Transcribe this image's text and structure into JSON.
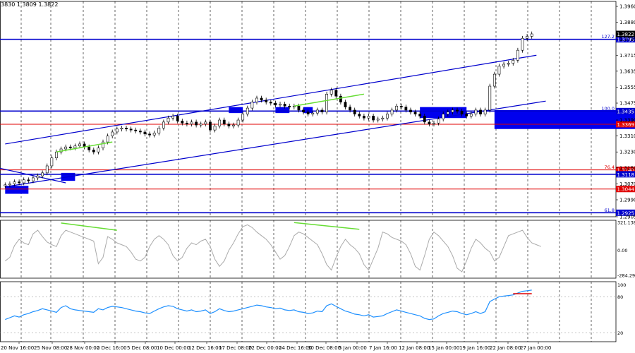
{
  "header": {
    "ohlc_text": "3830 1.3809 1.3822"
  },
  "chart_data": {
    "type": "candlestick",
    "price": {
      "ylim": [
        1.2905,
        1.3985
      ],
      "tick_labels": [
        "1.3960",
        "1.3880",
        "1.3795",
        "1.3715",
        "1.3635",
        "1.3555",
        "1.3475",
        "1.3390",
        "1.3310",
        "1.3230",
        "1.3150",
        "1.3070",
        "1.2990",
        "1.2905"
      ],
      "tick_values": [
        1.396,
        1.388,
        1.3795,
        1.3715,
        1.3635,
        1.3555,
        1.3475,
        1.339,
        1.331,
        1.323,
        1.315,
        1.307,
        1.299,
        1.2905
      ],
      "current_price": {
        "label": "1.3822",
        "value": 1.3822
      },
      "close_series": [
        1.3065,
        1.307,
        1.308,
        1.3075,
        1.309,
        1.3085,
        1.31,
        1.311,
        1.3125,
        1.316,
        1.32,
        1.323,
        1.3245,
        1.3255,
        1.325,
        1.326,
        1.327,
        1.3255,
        1.324,
        1.323,
        1.325,
        1.328,
        1.331,
        1.333,
        1.3345,
        1.335,
        1.3345,
        1.334,
        1.3335,
        1.333,
        1.332,
        1.3315,
        1.3325,
        1.335,
        1.338,
        1.34,
        1.341,
        1.3385,
        1.3375,
        1.337,
        1.338,
        1.3365,
        1.337,
        1.338,
        1.334,
        1.336,
        1.339,
        1.337,
        1.336,
        1.3365,
        1.339,
        1.342,
        1.345,
        1.348,
        1.35,
        1.349,
        1.348,
        1.3475,
        1.3465,
        1.347,
        1.346,
        1.3455,
        1.346,
        1.344,
        1.343,
        1.342,
        1.3425,
        1.344,
        1.343,
        1.352,
        1.354,
        1.351,
        1.348,
        1.3455,
        1.344,
        1.342,
        1.341,
        1.34,
        1.341,
        1.339,
        1.3395,
        1.34,
        1.342,
        1.344,
        1.346,
        1.3455,
        1.344,
        1.343,
        1.342,
        1.341,
        1.338,
        1.337,
        1.3375,
        1.3395,
        1.342,
        1.343,
        1.344,
        1.3435,
        1.342,
        1.341,
        1.342,
        1.344,
        1.342,
        1.344,
        1.356,
        1.362,
        1.366,
        1.367,
        1.3675,
        1.369,
        1.374,
        1.38,
        1.381,
        1.3822
      ],
      "lines": [
        {
          "label": "1.3795",
          "level_text": "127.2",
          "value": 1.3795,
          "color": "#0000cd"
        },
        {
          "label": "1.3435",
          "level_text": "100.0",
          "value": 1.3435,
          "color": "#0000cd"
        },
        {
          "label": "1.3369",
          "level_text": "",
          "value": 1.3369,
          "color": "#e00000"
        },
        {
          "label": "1.3140",
          "level_text": "76.4",
          "value": 1.314,
          "color": "#e00000"
        },
        {
          "label": "1.3118",
          "level_text": "",
          "value": 1.3118,
          "color": "#0000cd"
        },
        {
          "label": "1.3044",
          "level_text": "",
          "value": 1.3044,
          "color": "#e00000"
        },
        {
          "label": "1.2925",
          "level_text": "61.8",
          "value": 1.2925,
          "color": "#0000cd"
        }
      ],
      "channel": {
        "upper": [
          [
            0,
            1.327
          ],
          [
            114,
            1.3715
          ]
        ],
        "lower": [
          [
            0,
            1.3055
          ],
          [
            116,
            1.3485
          ]
        ],
        "color": "#0000cd"
      },
      "zones": [
        {
          "i0": 0,
          "i1": 5,
          "y0": 1.306,
          "y1": 1.302
        },
        {
          "i0": 12,
          "i1": 15,
          "y0": 1.3125,
          "y1": 1.3085
        },
        {
          "i0": 48,
          "i1": 51,
          "y0": 1.3455,
          "y1": 1.3425
        },
        {
          "i0": 58,
          "i1": 61,
          "y0": 1.3455,
          "y1": 1.3425
        },
        {
          "i0": 64,
          "i1": 66,
          "y0": 1.3455,
          "y1": 1.3425
        },
        {
          "i0": 89,
          "i1": 99,
          "y0": 1.3455,
          "y1": 1.34
        },
        {
          "i0": 105,
          "i1": 141,
          "y0": 1.344,
          "y1": 1.3345
        }
      ],
      "divergence_lines": [
        {
          "i0": 11,
          "v0": 1.323,
          "i1": 23,
          "v1": 1.328,
          "color": "#66dd33"
        },
        {
          "i0": 62,
          "v0": 1.346,
          "i1": 77,
          "v1": 1.352,
          "color": "#66dd33"
        }
      ]
    },
    "cci": {
      "tick_labels": [
        "321.1386",
        "0.00",
        "-284.290"
      ],
      "tick_values": [
        321.1386,
        0,
        -284.29
      ],
      "ylim": [
        -310,
        330
      ],
      "series": [
        -120,
        -80,
        50,
        120,
        80,
        60,
        180,
        220,
        150,
        90,
        60,
        40,
        160,
        220,
        200,
        180,
        160,
        140,
        120,
        100,
        -150,
        -80,
        150,
        120,
        80,
        60,
        40,
        -20,
        -100,
        -120,
        -80,
        40,
        120,
        160,
        120,
        60,
        -60,
        -120,
        -80,
        20,
        80,
        60,
        100,
        120,
        40,
        -100,
        -180,
        -120,
        0,
        80,
        180,
        260,
        280,
        250,
        200,
        160,
        120,
        60,
        -20,
        -100,
        -60,
        40,
        160,
        200,
        180,
        140,
        100,
        60,
        -40,
        -160,
        -220,
        -80,
        40,
        120,
        60,
        20,
        -40,
        -160,
        -220,
        -100,
        20,
        200,
        180,
        140,
        120,
        100,
        60,
        -40,
        -180,
        -220,
        -60,
        120,
        200,
        160,
        100,
        40,
        -60,
        -200,
        -240,
        -120,
        20,
        120,
        80,
        20,
        -20,
        -120,
        -80,
        40,
        160,
        180,
        200,
        220,
        140,
        80,
        60,
        40
      ]
    },
    "rsi": {
      "tick_labels": [
        "100",
        "80",
        "20"
      ],
      "tick_values": [
        100,
        80,
        20
      ],
      "ylim": [
        0,
        100
      ],
      "series": [
        42,
        45,
        48,
        46,
        50,
        52,
        55,
        57,
        60,
        58,
        56,
        54,
        62,
        65,
        60,
        58,
        57,
        56,
        55,
        54,
        60,
        58,
        62,
        64,
        63,
        62,
        60,
        58,
        56,
        55,
        53,
        52,
        56,
        60,
        63,
        65,
        64,
        60,
        58,
        56,
        58,
        55,
        56,
        58,
        52,
        55,
        60,
        57,
        55,
        56,
        58,
        60,
        62,
        64,
        66,
        65,
        63,
        62,
        60,
        61,
        58,
        57,
        58,
        55,
        54,
        52,
        53,
        56,
        55,
        65,
        68,
        64,
        60,
        56,
        54,
        51,
        50,
        48,
        50,
        46,
        47,
        48,
        52,
        55,
        58,
        56,
        54,
        52,
        50,
        48,
        44,
        42,
        43,
        48,
        52,
        54,
        56,
        55,
        52,
        50,
        52,
        55,
        52,
        55,
        72,
        76,
        80,
        81,
        82,
        83,
        86,
        89,
        90,
        91
      ],
      "ref_line": {
        "y": 85,
        "color": "#e00000"
      }
    },
    "x_tick_labels": [
      "20 Nov 16:00",
      "25 Nov 08:00",
      "28 Nov 00:00",
      "2 Dec 16:00",
      "5 Dec 08:00",
      "10 Dec 00:00",
      "12 Dec 16:00",
      "17 Dec 08:00",
      "22 Dec 00:00",
      "24 Dec 16:00",
      "30 Dec 08:00",
      "5 Jan 00:00",
      "7 Jan 16:00",
      "12 Jan 08:00",
      "15 Jan 00:00",
      "19 Jan 16:00",
      "22 Jan 08:00",
      "27 Jan 00:00"
    ]
  }
}
